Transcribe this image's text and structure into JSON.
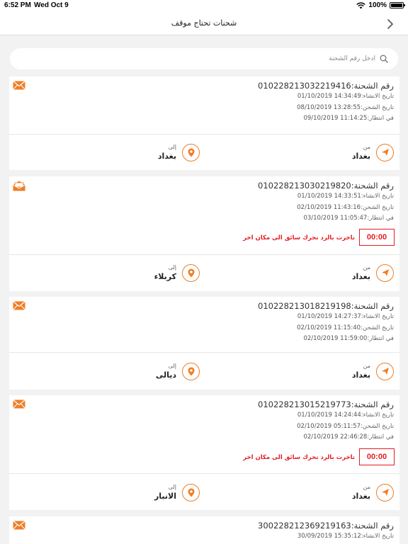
{
  "status_bar": {
    "time": "6:52 PM",
    "date": "Wed Oct 9",
    "battery": "100%"
  },
  "nav": {
    "title": "شحنات تحتاج موقف"
  },
  "search": {
    "placeholder": "ادخل رقم الشحنة",
    "value": ""
  },
  "labels": {
    "shipment_number": "رقم الشحنة:",
    "created": "تاريخ الانشاء:",
    "shipped": "تاريخ الشحن:",
    "waiting": "في انتظار:",
    "from": "من",
    "to": "إلى"
  },
  "colors": {
    "accent": "#ef7d26",
    "alert": "#e51c23"
  },
  "cards": [
    {
      "icon": "mail-icon",
      "number": "010228213032219416",
      "created": "01/10/2019 14:34:49",
      "shipped": "08/10/2019 13:28:55",
      "waiting": "09/10/2019 11:14:25",
      "from_city": "بغداد",
      "to_city": "بغداد"
    },
    {
      "icon": "mail-open-icon",
      "number": "010228213030219820",
      "created": "01/10/2019 14:33:51",
      "shipped": "02/10/2019 11:43:16",
      "waiting": "03/10/2019 11:05:47",
      "timer": "00:00",
      "late_message": "تاخرت بالرد تحرك سائق الى مكان اخر",
      "from_city": "بغداد",
      "to_city": "كربلاء"
    },
    {
      "icon": "mail-icon",
      "number": "010228213018219198",
      "created": "01/10/2019 14:27:37",
      "shipped": "02/10/2019 11:15:40",
      "waiting": "02/10/2019 11:59:00",
      "from_city": "بغداد",
      "to_city": "ديالى"
    },
    {
      "icon": "mail-icon",
      "number": "010228213015219773",
      "created": "01/10/2019 14:24:44",
      "shipped": "02/10/2019 05:11:57",
      "waiting": "02/10/2019 22:46:28",
      "timer": "00:00",
      "late_message": "تاخرت بالرد تحرك سائق الى مكان اخر",
      "from_city": "بغداد",
      "to_city": "الانبار"
    },
    {
      "icon": "mail-icon",
      "number": "300228212369219163",
      "created": "30/09/2019 15:35:12"
    }
  ]
}
